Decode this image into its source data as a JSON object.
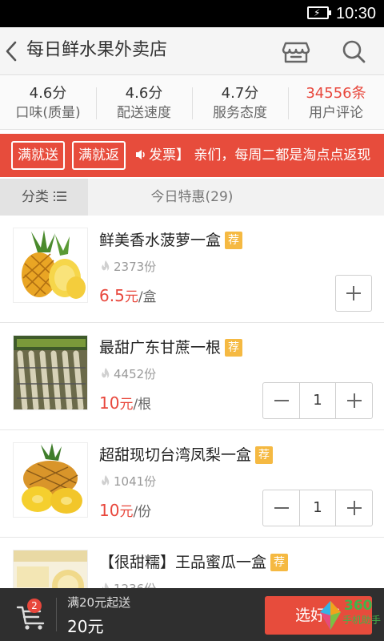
{
  "status_bar": {
    "time": "10:30",
    "battery_icon": "charging-battery-icon"
  },
  "header": {
    "title": "每日鲜水果外卖店",
    "back_icon": "back-arrow-icon",
    "shop_icon": "storefront-icon",
    "search_icon": "search-icon"
  },
  "ratings": [
    {
      "value": "4.6分",
      "label": "口味(质量)"
    },
    {
      "value": "4.6分",
      "label": "配送速度"
    },
    {
      "value": "4.7分",
      "label": "服务态度"
    },
    {
      "value_number": "34556",
      "value_unit": "条",
      "label": "用户评论"
    }
  ],
  "promo": {
    "tag1": "满就送",
    "tag2": "满就返",
    "marquee": "发票】 亲们，每周二都是淘点点返现",
    "speaker_icon": "speaker-icon"
  },
  "tabs": {
    "category": "分类",
    "category_icon": "list-menu-icon",
    "special": "今日特惠(29)"
  },
  "products": [
    {
      "name": "鲜美香水菠萝一盒",
      "badge": "荐",
      "sold": "2373份",
      "price": "6.5",
      "currency": "元",
      "unit": "/盒",
      "quantity": null
    },
    {
      "name": "最甜广东甘蔗一根",
      "badge": "荐",
      "sold": "4452份",
      "price": "10",
      "currency": "元",
      "unit": "/根",
      "quantity": "1"
    },
    {
      "name": "超甜现切台湾凤梨一盒",
      "badge": "荐",
      "sold": "1041份",
      "price": "10",
      "currency": "元",
      "unit": "/份",
      "quantity": "1"
    },
    {
      "name": "【很甜糯】王品蜜瓜一盒",
      "badge": "荐",
      "sold": "1236份",
      "price": "",
      "currency": "",
      "unit": "",
      "quantity": null
    }
  ],
  "bottom_bar": {
    "cart_icon": "shopping-cart-icon",
    "cart_count": "2",
    "min_order": "满20元起送",
    "total": "20元",
    "checkout_label": "选好了"
  },
  "watermark": {
    "line1": "360",
    "line2": "手机助手"
  },
  "colors": {
    "accent": "#e74c3c",
    "price": "#e8473c",
    "badge": "#f5b942",
    "bottom_bar": "#2f2f2f"
  }
}
